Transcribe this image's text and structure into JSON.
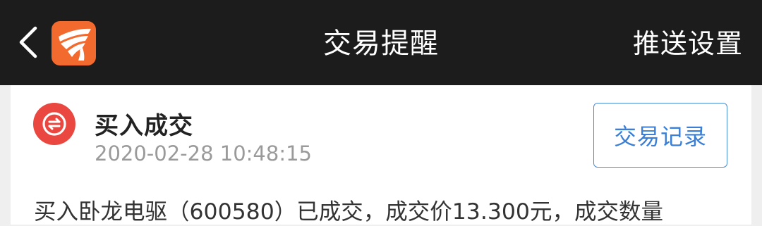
{
  "header": {
    "back_icon": "chevron-left-icon",
    "logo_icon": "app-logo-icon",
    "title": "交易提醒",
    "right_action": "推送设置"
  },
  "card": {
    "icon": "exchange-icon",
    "title": "买入成交",
    "time": "2020-02-28 10:48:15",
    "records_button": "交易记录",
    "message": "买入卧龙电驱（600580）已成交，成交价13.300元，成交数量"
  },
  "colors": {
    "header_bg": "#1c1c1c",
    "logo_orange": "#f26a2e",
    "icon_red": "#e9473f",
    "accent_blue": "#3a7fd5",
    "timestamp_gray": "#9a9a9a"
  }
}
